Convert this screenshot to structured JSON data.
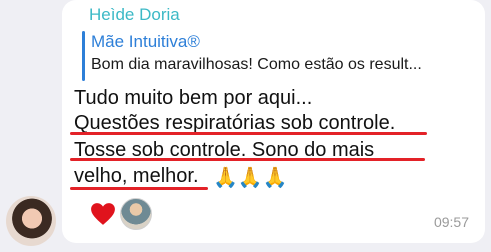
{
  "message": {
    "sender": "Heìde Doria",
    "reply": {
      "author": "Mãe Intuitiva®",
      "text": "Bom dia maravilhosas! Como estão os result..."
    },
    "lines": [
      "Tudo muito bem por aqui...",
      "Questões respiratórias sob controle.",
      "Tosse sob controle. Sono do mais",
      "velho, melhor."
    ],
    "emoji": "🙏🙏🙏",
    "time": "09:57"
  },
  "reactions": [
    "heart-reaction",
    "reactor-avatar"
  ],
  "colors": {
    "sender": "#3cb9c6",
    "reply_accent": "#2d7fd8",
    "underline": "#e32228",
    "heart": "#e0131d"
  }
}
